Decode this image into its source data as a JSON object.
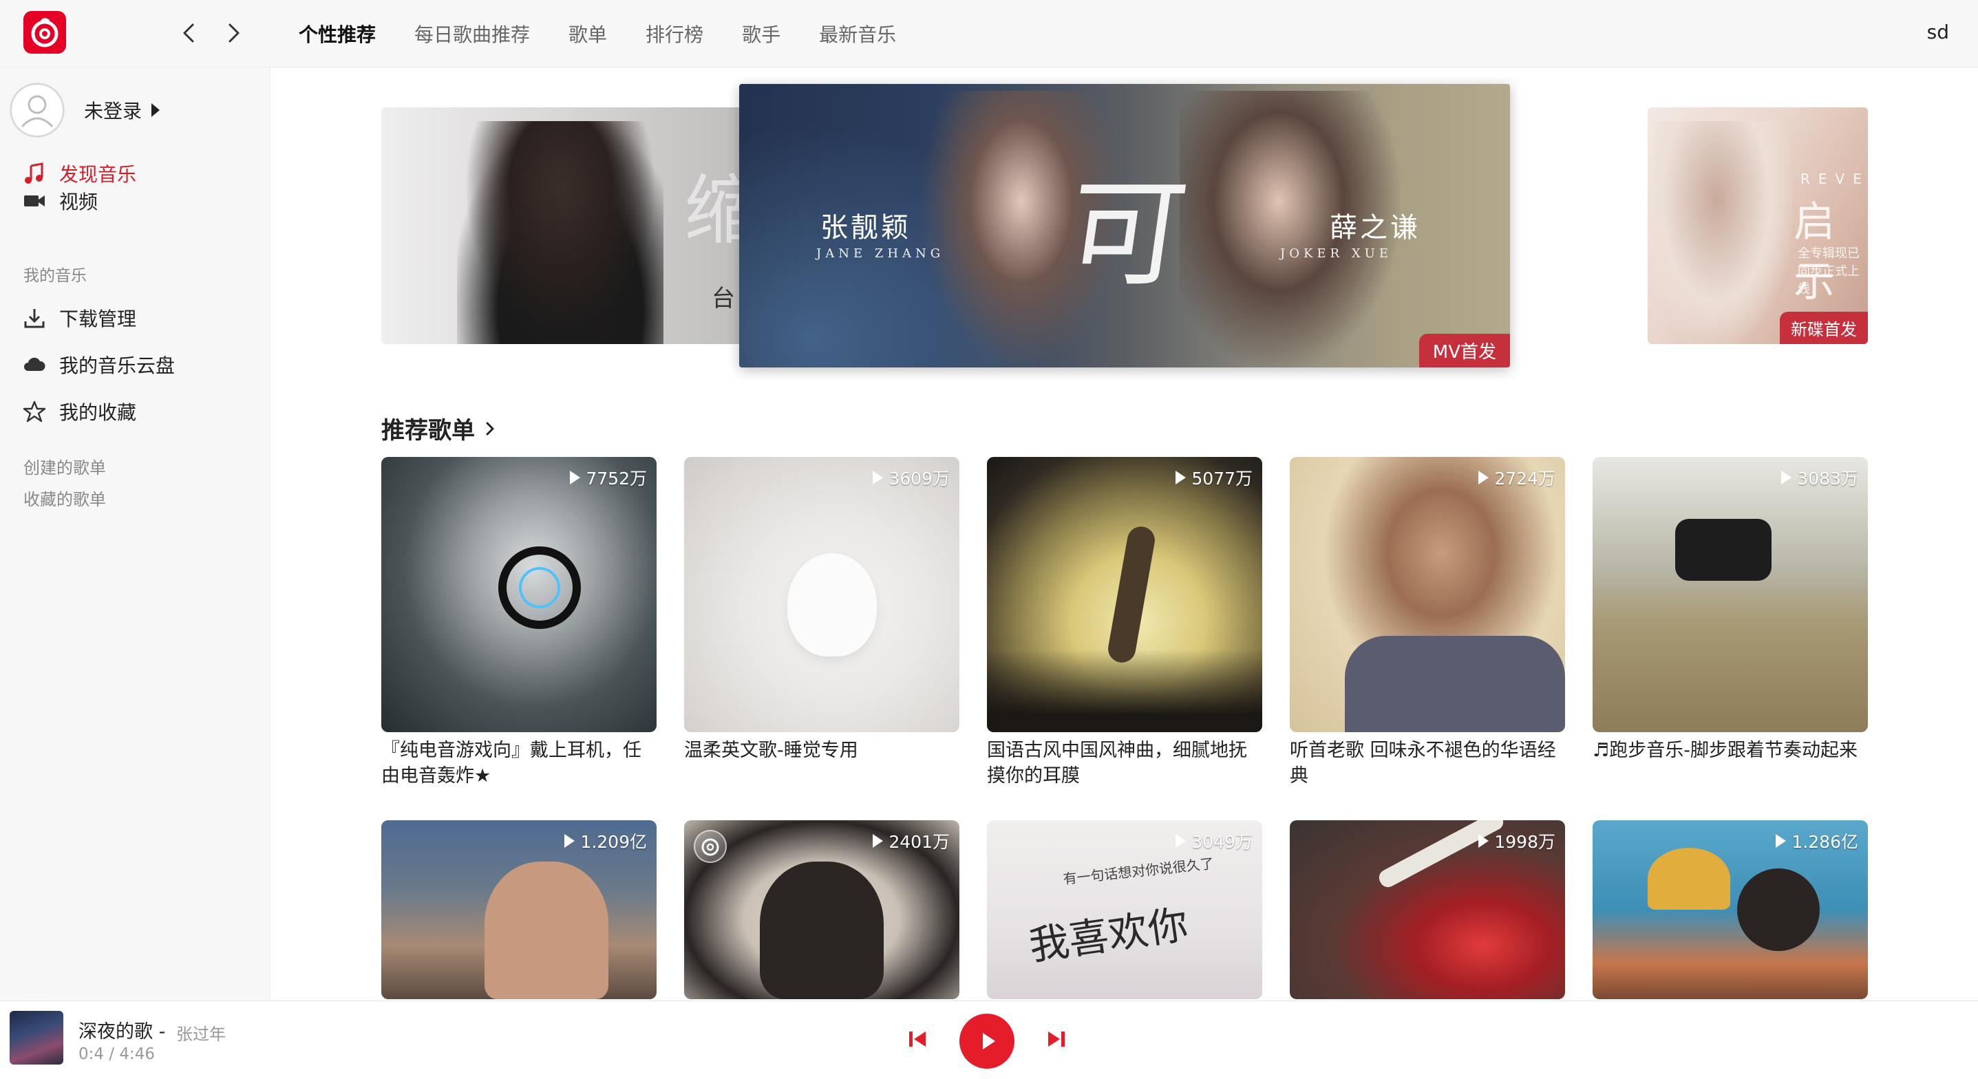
{
  "colors": {
    "accent": "#e51d2b",
    "sidebar_bg": "#f7f7f7",
    "active_text": "#d4202b"
  },
  "header": {
    "tabs": [
      {
        "label": "个性推荐",
        "active": true
      },
      {
        "label": "每日歌曲推荐",
        "active": false
      },
      {
        "label": "歌单",
        "active": false
      },
      {
        "label": "排行榜",
        "active": false
      },
      {
        "label": "歌手",
        "active": false
      },
      {
        "label": "最新音乐",
        "active": false
      }
    ],
    "user_short": "sd"
  },
  "sidebar": {
    "login_label": "未登录",
    "nav": [
      {
        "label": "发现音乐",
        "icon": "music-note-icon",
        "active": true
      },
      {
        "label": "视频",
        "icon": "video-icon",
        "active": false
      }
    ],
    "my_music_heading": "我的音乐",
    "my_music": [
      {
        "label": "下载管理",
        "icon": "download-icon"
      },
      {
        "label": "我的音乐云盘",
        "icon": "cloud-icon"
      },
      {
        "label": "我的收藏",
        "icon": "star-icon"
      }
    ],
    "created_playlists": "创建的歌单",
    "collected_playlists": "收藏的歌单"
  },
  "banners": {
    "left": {
      "char": "缩",
      "small_char": "台"
    },
    "center": {
      "big_char": "可",
      "name_a": "张靓颖",
      "name_a_en": "JANE ZHANG",
      "name_b": "薛之谦",
      "name_b_en": "JOKER XUE",
      "tag": "MV首发"
    },
    "right": {
      "reveal": "REVELATION",
      "title": "启示录",
      "subtitle": "全专辑现已同步正式上线",
      "tag": "新碟首发"
    }
  },
  "recommended": {
    "title": "推荐歌单",
    "playlists": [
      {
        "plays": "7752万",
        "title": "『纯电音游戏向』戴上耳机，任由电音轰炸★"
      },
      {
        "plays": "3609万",
        "title": "温柔英文歌-睡觉专用"
      },
      {
        "plays": "5077万",
        "title": "国语古风中国风神曲，细腻地抚摸你的耳膜"
      },
      {
        "plays": "2724万",
        "title": "听首老歌 回味永不褪色的华语经典"
      },
      {
        "plays": "3083万",
        "title": "♬跑步音乐-脚步跟着节奏动起来"
      },
      {
        "plays": "1.209亿",
        "title": ""
      },
      {
        "plays": "2401万",
        "title": ""
      },
      {
        "plays": "3049万",
        "title": "",
        "handwriting": "我喜欢你",
        "handwriting_top": "有一句话想对你说很久了"
      },
      {
        "plays": "1998万",
        "title": ""
      },
      {
        "plays": "1.286亿",
        "title": ""
      }
    ]
  },
  "player": {
    "song": "深夜的歌 -",
    "artist": "张过年",
    "time": "0:4 / 4:46"
  }
}
